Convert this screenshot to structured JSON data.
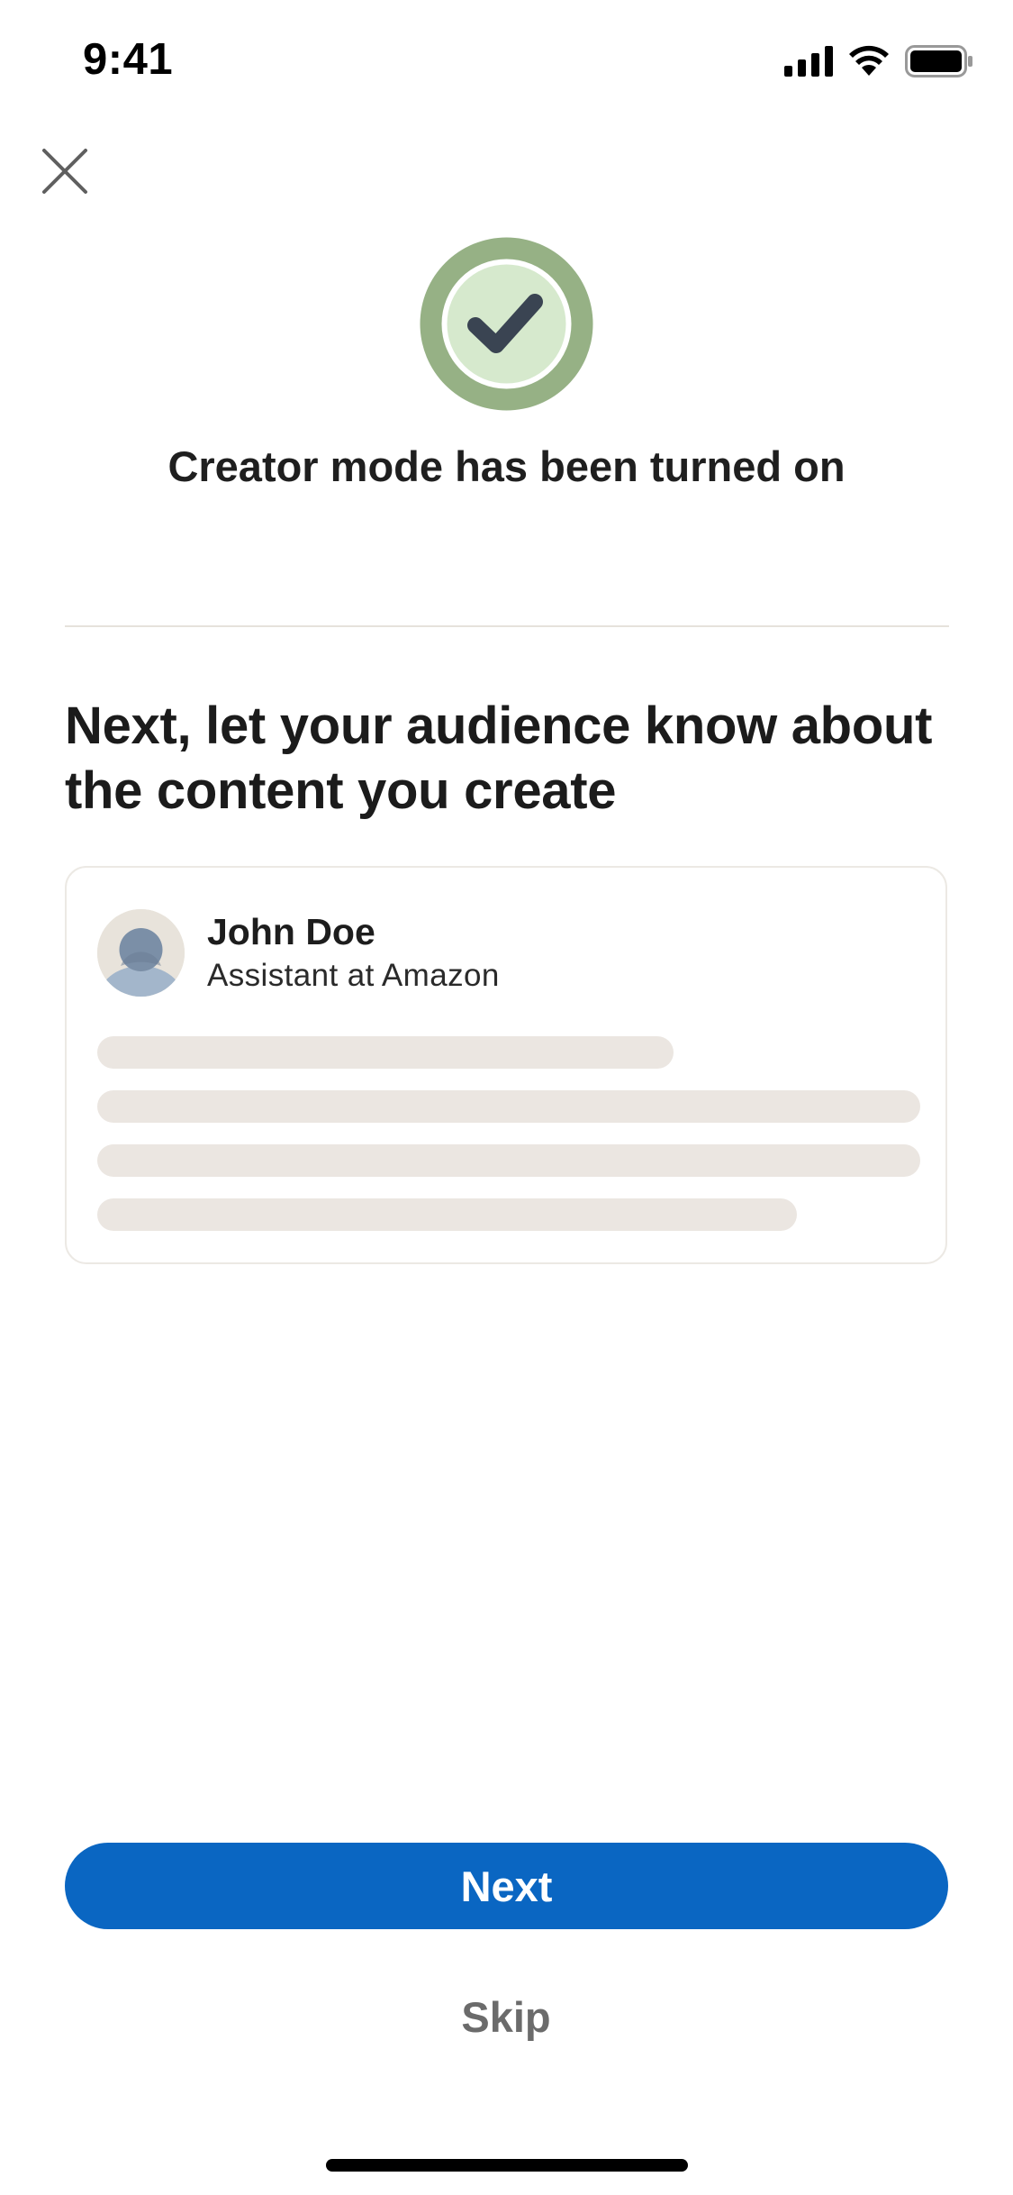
{
  "status_bar": {
    "time": "9:41",
    "icons": [
      "cellular-signal-icon",
      "wifi-icon",
      "battery-icon"
    ]
  },
  "header": {
    "close_icon": "close-icon"
  },
  "confirmation": {
    "icon": "checkmark-icon",
    "title": "Creator mode has been turned on",
    "colors": {
      "ring": "#96b185",
      "inner": "#d6e9cd",
      "check": "#3a4452"
    }
  },
  "main": {
    "headline": "Next, let your audience know about the content you create"
  },
  "preview_card": {
    "avatar_icon": "default-avatar-icon",
    "name": "John Doe",
    "headline": "Assistant at Amazon"
  },
  "actions": {
    "next_label": "Next",
    "skip_label": "Skip"
  },
  "colors": {
    "primary": "#0a66c2",
    "skeleton": "#ebe6e1",
    "muted_text": "#6b6b6b"
  }
}
